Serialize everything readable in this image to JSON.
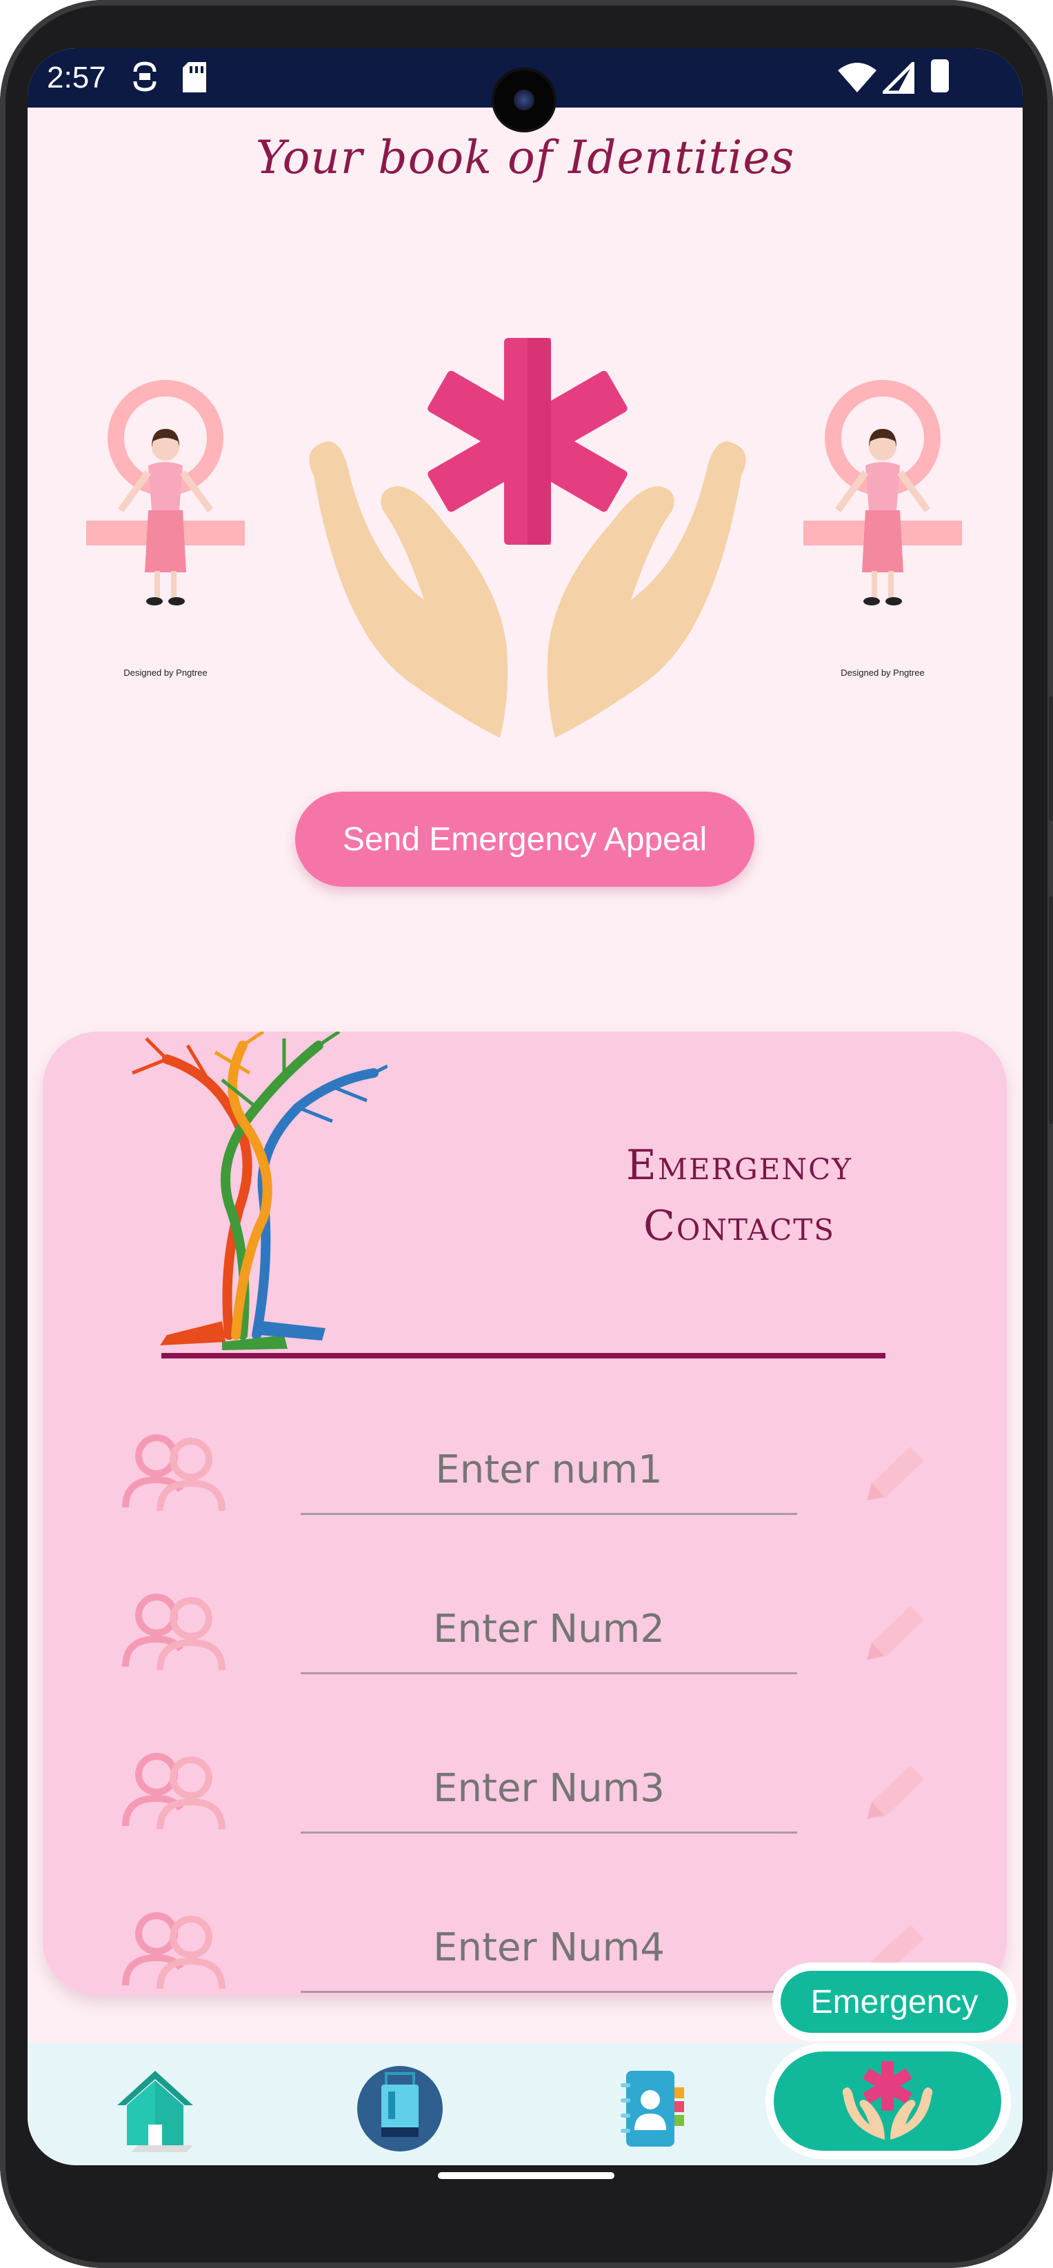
{
  "status_bar": {
    "time": "2:57",
    "icons": [
      "sync-icon",
      "sd-card-icon",
      "wifi-icon",
      "signal-icon",
      "battery-icon"
    ]
  },
  "header": {
    "title": "Your book of Identities"
  },
  "hero": {
    "left_emblem_caption": "Designed by Pngtree",
    "right_emblem_caption": "Designed by Pngtree",
    "center_icon": "hands-star-of-life-icon"
  },
  "appeal_button": {
    "label": "Send Emergency Appeal"
  },
  "contacts_card": {
    "heading_line1": "Emergency",
    "heading_line2": "Contacts",
    "rows": [
      {
        "placeholder": "Enter num1"
      },
      {
        "placeholder": "Enter Num2"
      },
      {
        "placeholder": "Enter Num3"
      },
      {
        "placeholder": "Enter Num4"
      }
    ]
  },
  "emergency_chip": {
    "label": "Emergency"
  },
  "bottom_nav": {
    "items": [
      {
        "icon": "home-icon"
      },
      {
        "icon": "identity-card-icon"
      },
      {
        "icon": "contact-book-icon"
      },
      {
        "icon": "emergency-hands-icon",
        "active": true
      }
    ]
  },
  "colors": {
    "background": "#fdeff4",
    "accent_pink": "#f575a9",
    "card_pink": "#fbcbe1",
    "heading_maroon": "#7a1746",
    "teal": "#12b89a",
    "status_bar": "#0c1a44"
  }
}
